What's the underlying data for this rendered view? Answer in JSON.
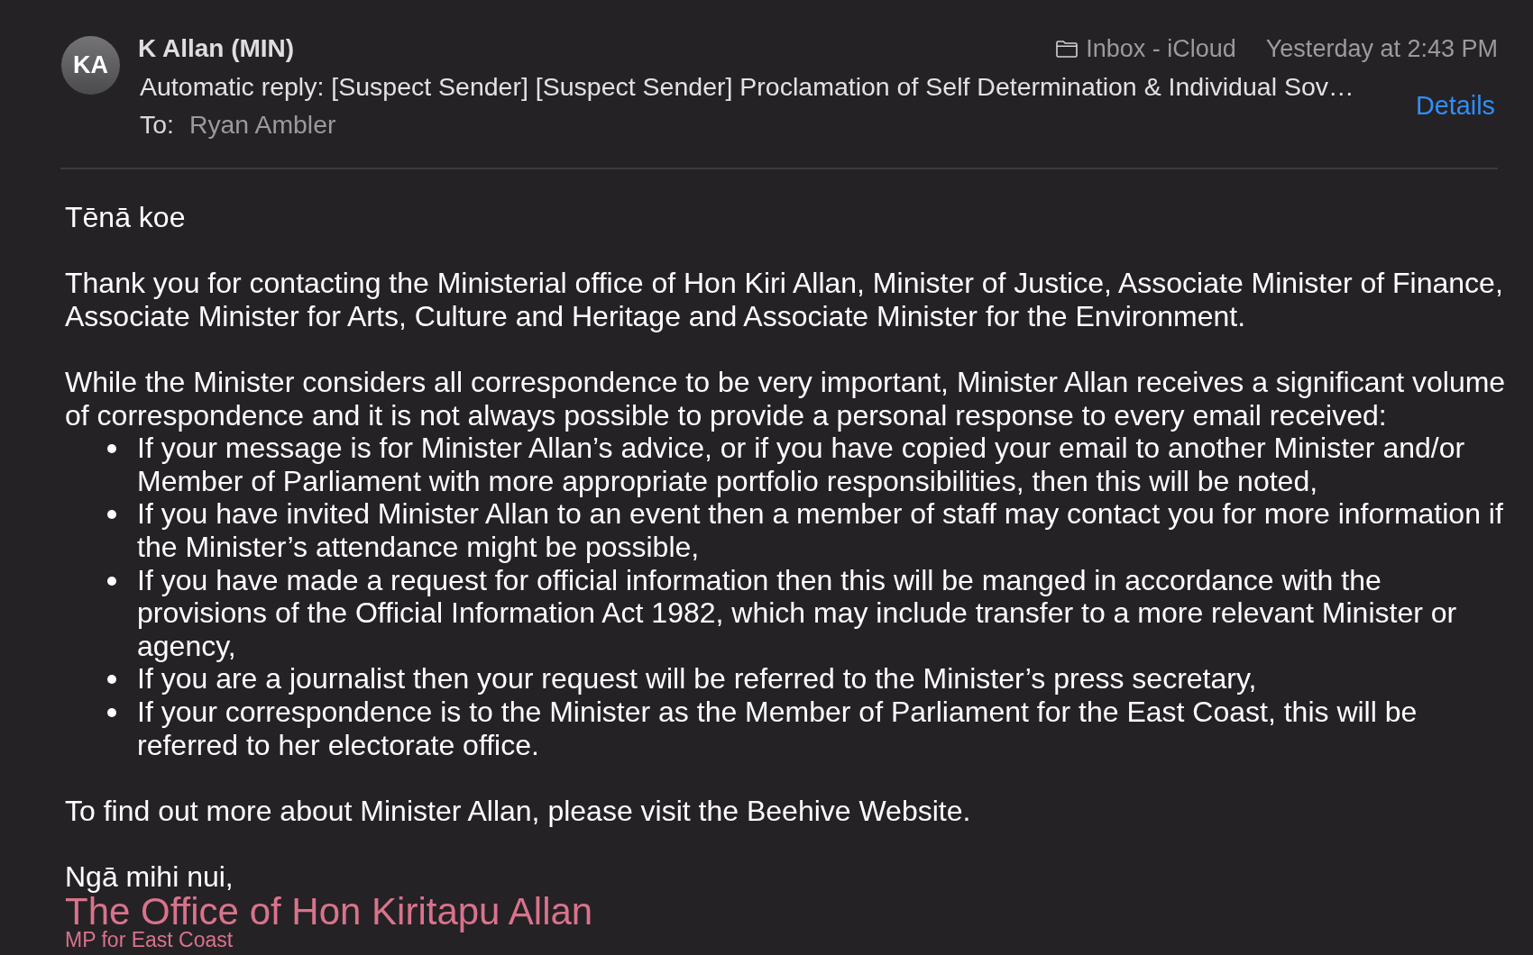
{
  "message_header": {
    "avatar_initials": "KA",
    "sender": "K Allan (MIN)",
    "mailbox": "Inbox - iCloud",
    "date": "Yesterday at 2:43 PM",
    "subject": "Automatic reply: [Suspect Sender] [Suspect Sender] Proclamation of Self Determination & Individual Sov…",
    "to_label": "To:",
    "recipient": "Ryan Ambler",
    "details_link": "Details"
  },
  "body": {
    "greeting": "Tēnā koe",
    "paragraphs": [
      "Thank you for contacting the Ministerial office of Hon Kiri Allan, Minister of Justice, Associate Minister of Finance, Associate Minister for Arts, Culture and Heritage and Associate Minister for the Environment.",
      "While the Minister considers all correspondence to be very important, Minister Allan receives a significant volume of correspondence and it is not always possible to provide a personal response to every email received:"
    ],
    "bullets": [
      "If your message is for Minister Allan’s advice, or if you have copied your email to another Minister and/or Member of Parliament with more appropriate portfolio responsibilities, then this will be noted,",
      "If you have invited Minister Allan to an event then a member of staff may contact you for more information if the Minister’s attendance might be possible,",
      "If you have made a request for official information then this will be manged in accordance with the provisions of the Official Information Act 1982, which may include transfer to a more relevant Minister or agency,",
      "If you are a journalist then your request will be referred to the Minister’s press secretary,",
      "If your correspondence is to the Minister as the Member of Parliament for the East Coast, this will be referred to her electorate office."
    ],
    "closing": "To find out more about Minister Allan, please visit the Beehive Website.",
    "sign_off": "Ngā mihi nui,",
    "signature": {
      "name": "The Office of Hon Kiritapu Allan",
      "title": "MP for East Coast"
    }
  }
}
